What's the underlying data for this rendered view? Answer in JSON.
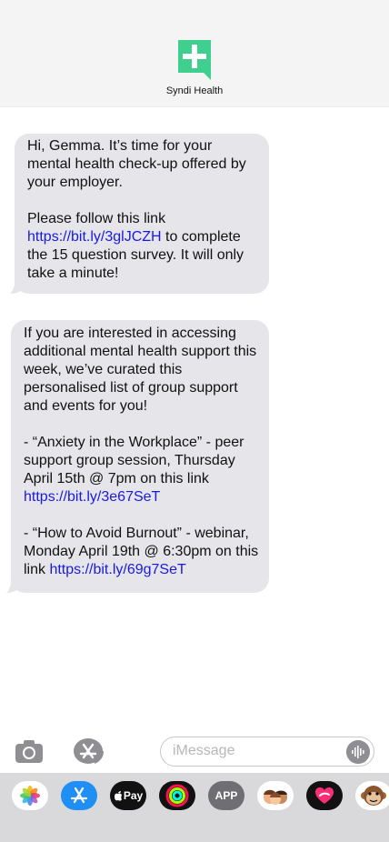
{
  "contact": {
    "name": "Syndi Health",
    "logo_icon": "plus-chat-icon",
    "brand_color": "#3fcf8e"
  },
  "messages": [
    {
      "paragraphs": [
        {
          "parts": [
            {
              "text": "Hi, Gemma. It’s time for your mental health check-up offered by your employer."
            }
          ]
        },
        {
          "parts": [
            {
              "text": "Please follow this link "
            },
            {
              "text": "https://bit.ly/3glJCZH",
              "link": true
            },
            {
              "text": " to complete the 15 question survey. It will only take a minute!"
            }
          ]
        }
      ]
    },
    {
      "paragraphs": [
        {
          "parts": [
            {
              "text": "If you are interested in accessing additional mental health support this week, we’ve curated this personalised list of group support and events for you!"
            }
          ]
        },
        {
          "parts": [
            {
              "text": "- “Anxiety in the Workplace” - peer support group session, Thursday April 15th @ 7pm on this link "
            },
            {
              "text": "https://bit.ly/3e67SeT",
              "link": true
            }
          ]
        },
        {
          "parts": [
            {
              "text": "- “How to Avoid Burnout” - webinar, Monday April 19th @ 6:30pm on this link "
            },
            {
              "text": "https://bit.ly/69g7SeT",
              "link": true
            }
          ]
        }
      ]
    }
  ],
  "composer": {
    "placeholder": "iMessage",
    "camera_icon": "camera-icon",
    "apps_icon": "app-store-icon",
    "audio_icon": "audio-waveform-icon"
  },
  "app_tray": {
    "apps": [
      {
        "name": "photos-icon",
        "label": ""
      },
      {
        "name": "app-store-icon",
        "label": ""
      },
      {
        "name": "apple-pay-icon",
        "label": "Pay"
      },
      {
        "name": "activity-rings-icon",
        "label": ""
      },
      {
        "name": "app-clips-icon",
        "label": "APP"
      },
      {
        "name": "memoji-icon",
        "label": ""
      },
      {
        "name": "digital-touch-icon",
        "label": ""
      },
      {
        "name": "animoji-monkey-icon",
        "label": ""
      }
    ]
  },
  "colors": {
    "bubble_bg": "#e5e5ea",
    "link": "#1a1adf",
    "header_bg": "#f4f4f4",
    "tray_bg": "#d9d9dc"
  }
}
